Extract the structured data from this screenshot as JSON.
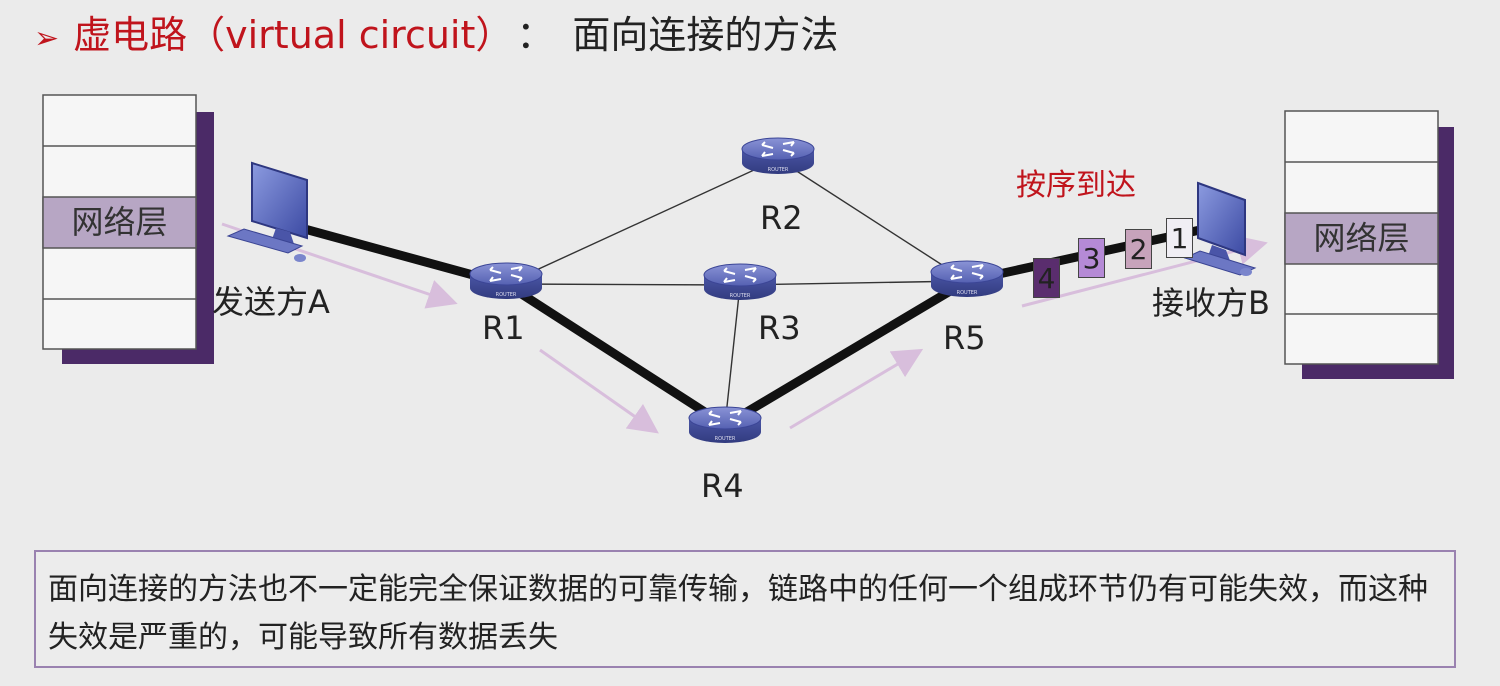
{
  "header": {
    "bullet": "➢",
    "title_red": "虚电路（virtual circuit）",
    "separator": "：",
    "title_dark": "面向连接的方法"
  },
  "sender": {
    "layer_label": "网络层",
    "host_label": "发送方A"
  },
  "receiver": {
    "layer_label": "网络层",
    "host_label": "接收方B"
  },
  "routers": [
    {
      "id": "r1",
      "label": "R1"
    },
    {
      "id": "r2",
      "label": "R2"
    },
    {
      "id": "r3",
      "label": "R3"
    },
    {
      "id": "r4",
      "label": "R4"
    },
    {
      "id": "r5",
      "label": "R5"
    }
  ],
  "in_order_label": "按序到达",
  "packets": [
    {
      "label": "4",
      "color": "#5a2d6e"
    },
    {
      "label": "3",
      "color": "#b58ad6"
    },
    {
      "label": "2",
      "color": "#c7a3bb"
    },
    {
      "label": "1",
      "color": "#f0eef4"
    }
  ],
  "note": "面向连接的方法也不一定能完全保证数据的可靠传输，链路中的任何一个组成环节仍有可能失效，而这种失效是严重的，可能导致所有数据丢失",
  "colors": {
    "title_red": "#c0141c",
    "router_blue": "#5a66b8",
    "stack_shadow": "#4b2a67",
    "layer_highlight": "#b7a6c4",
    "arrow": "#d8bedc"
  }
}
